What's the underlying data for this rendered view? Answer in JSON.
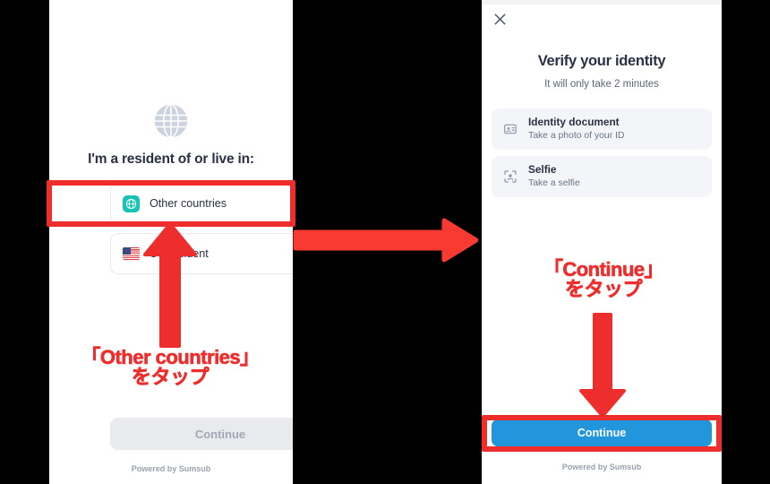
{
  "colors": {
    "background": "#000000",
    "panel": "#ffffff",
    "annotation_red": "#ee2d2d",
    "primary_blue": "#2196dd",
    "teal_badge": "#17c3b2",
    "disabled_gray": "#e8eaed",
    "text_dark": "#2a3142",
    "text_muted": "#6b7486"
  },
  "left_screen": {
    "hero_icon": "globe-icon",
    "heading": "I'm a resident of or live in:",
    "options": [
      {
        "label": "Other countries",
        "icon": "globe-badge-icon",
        "selected": false,
        "radio": "radio-unselected-icon"
      },
      {
        "label": "US resident",
        "icon": "us-flag-icon",
        "selected": false,
        "radio": "radio-unselected-icon"
      }
    ],
    "continue_button": {
      "label": "Continue",
      "state": "disabled"
    },
    "footer": "Powered by Sumsub"
  },
  "right_screen": {
    "close_icon": "close-icon",
    "heading": "Verify your identity",
    "subheading": "It will only take 2 minutes",
    "steps": [
      {
        "title": "Identity document",
        "subtitle": "Take a photo of your ID",
        "icon": "id-card-icon"
      },
      {
        "title": "Selfie",
        "subtitle": "Take a selfie",
        "icon": "face-scan-icon"
      }
    ],
    "continue_button": {
      "label": "Continue",
      "state": "enabled"
    },
    "footer": "Powered by Sumsub"
  },
  "annotations": {
    "left": {
      "line1": "「Other countries」",
      "line2": "をタップ",
      "arrow": "arrow-up-icon"
    },
    "middle": {
      "arrow": "arrow-right-icon"
    },
    "right": {
      "line1": "「Continue」",
      "line2": "をタップ",
      "arrow": "arrow-down-icon"
    }
  }
}
